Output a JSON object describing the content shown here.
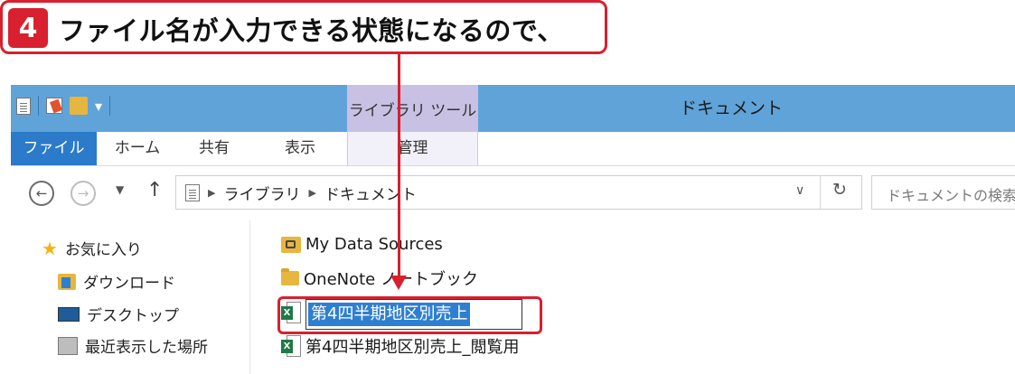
{
  "callout": {
    "step_number": "4",
    "text": "ファイル名が入力できる状態になるので、"
  },
  "window": {
    "title": "ドキュメント",
    "tool_tab_label": "ライブラリ ツール",
    "ribbon_tabs": {
      "file": "ファイル",
      "home": "ホーム",
      "share": "共有",
      "view": "表示",
      "manage": "管理"
    },
    "address": {
      "crumbs": [
        "ライブラリ",
        "ドキュメント"
      ],
      "search_placeholder": "ドキュメントの検索"
    },
    "nav_pane": {
      "favorites": "お気に入り",
      "items": [
        "ダウンロード",
        "デスクトップ",
        "最近表示した場所"
      ]
    },
    "files": {
      "items": [
        "My Data Sources",
        "OneNote ノートブック"
      ],
      "renaming_value": "第4四半期地区別売上",
      "last": "第4四半期地区別売上_閲覧用"
    }
  },
  "colors": {
    "accent_red": "#d8202e",
    "titlebar": "#5fa3d9",
    "file_tab": "#2b7bca",
    "tool_tab": "#c8c1e3",
    "selection": "#2f7fd0"
  }
}
